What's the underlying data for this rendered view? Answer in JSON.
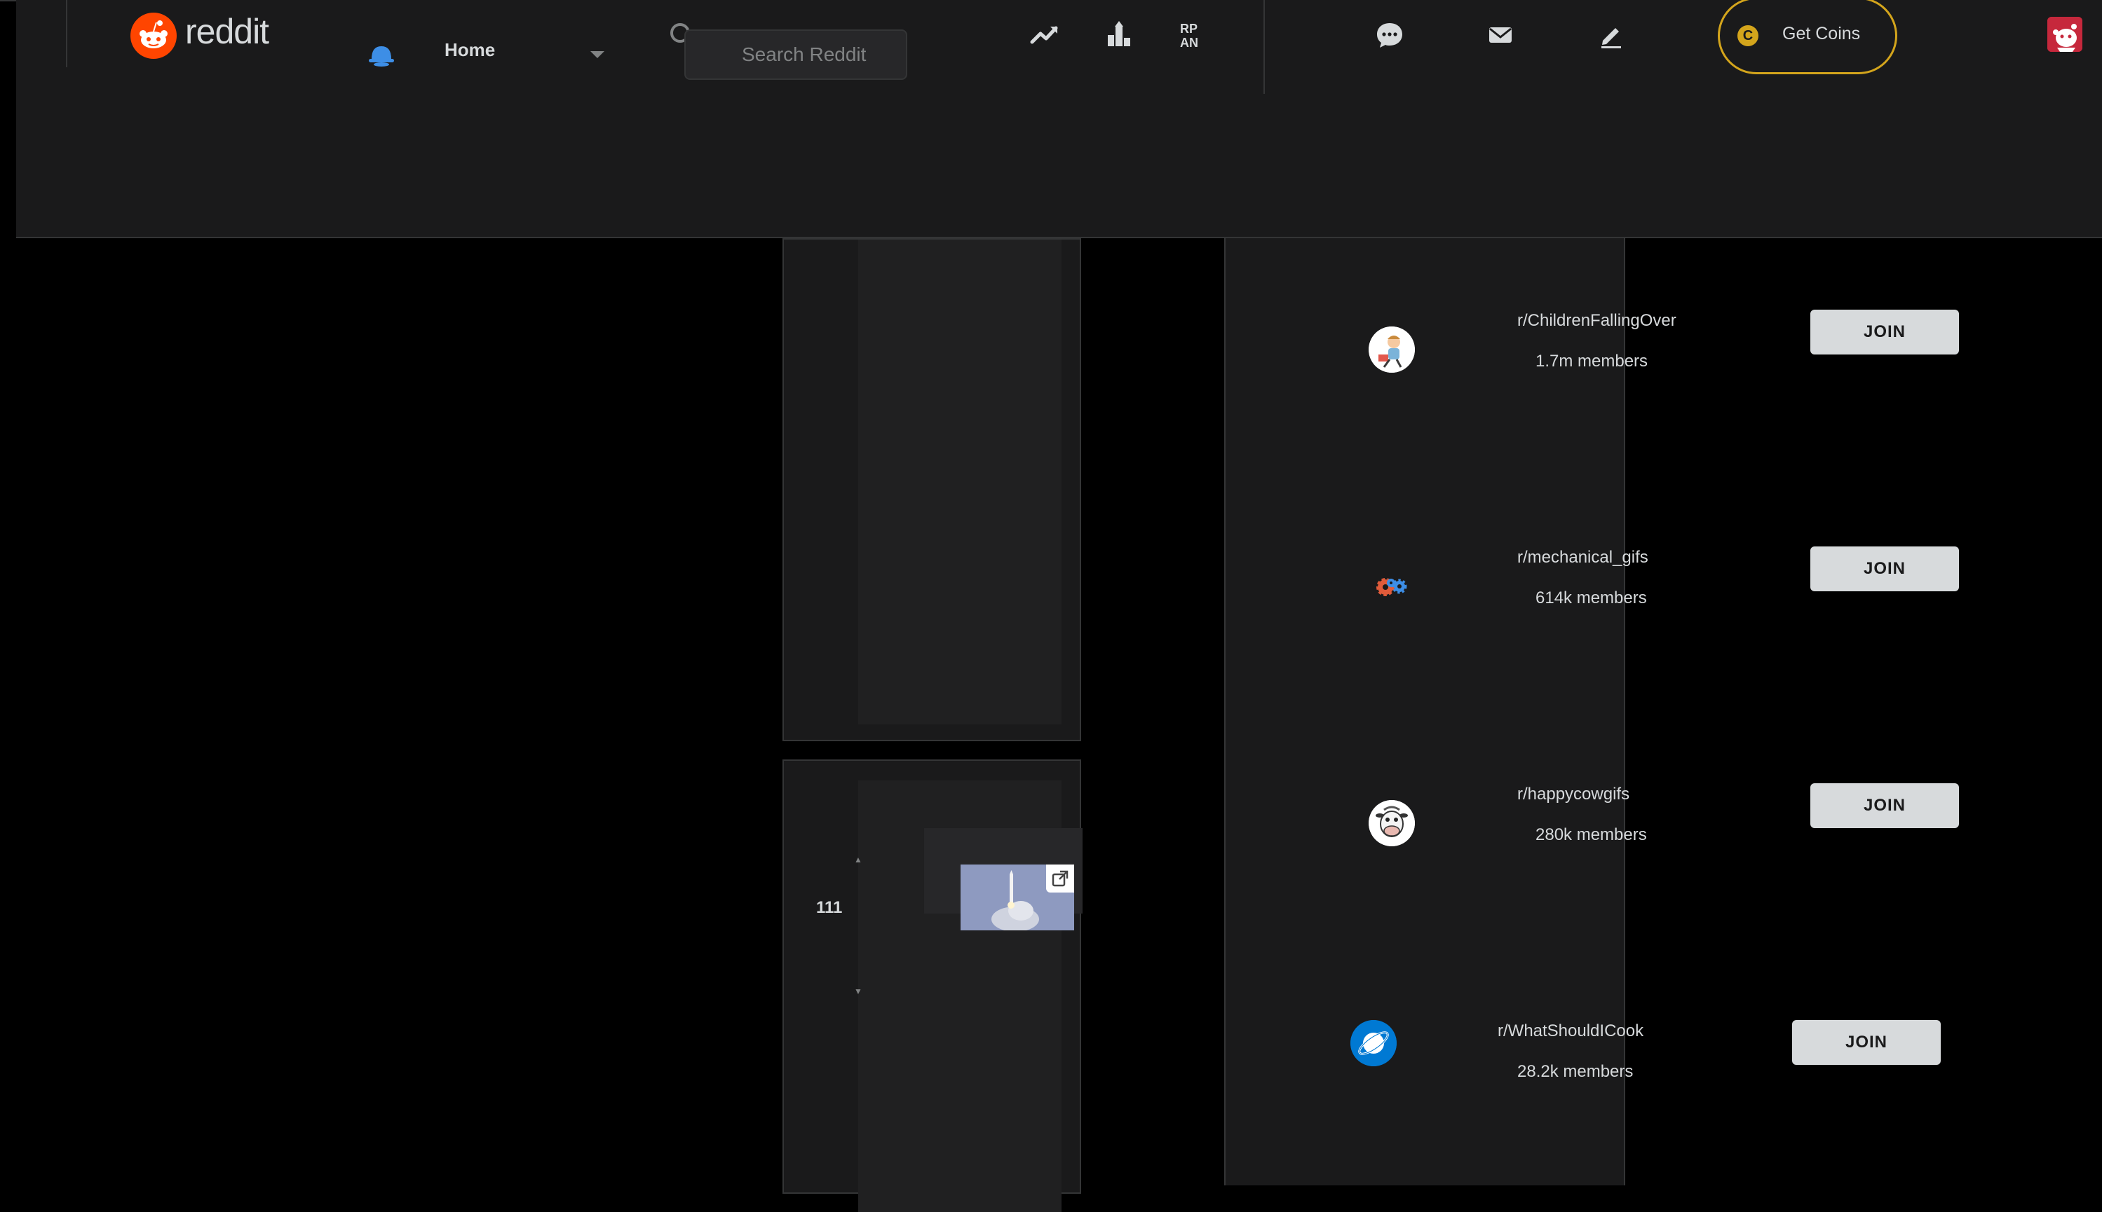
{
  "header": {
    "logo_text": "reddit",
    "home_label": "Home",
    "search": {
      "placeholder": "Search Reddit"
    },
    "nav_icons": [
      "trending-icon",
      "leaderboard-icon",
      "rpan-icon",
      "chat-icon",
      "mail-icon",
      "create-post-icon"
    ],
    "coins": {
      "symbol": "C",
      "label": "Get Coins",
      "color": "#d4a51c"
    },
    "avatar_icon": "snoo-avatar-icon"
  },
  "feed": {
    "posts": [
      {
        "votes": ""
      },
      {
        "votes": "111",
        "thumbnail_icon": "rocket-launch-thumbnail",
        "external_link_icon": "external-link-icon"
      }
    ]
  },
  "sidebar": {
    "communities": [
      {
        "name": "r/ChildrenFallingOver",
        "members": "1.7m members",
        "join_label": "JOIN",
        "icon": "children-cartoon-icon"
      },
      {
        "name": "r/mechanical_gifs",
        "members": "614k members",
        "join_label": "JOIN",
        "icon": "gears-icon"
      },
      {
        "name": "r/happycowgifs",
        "members": "280k members",
        "join_label": "JOIN",
        "icon": "cow-cartoon-icon"
      },
      {
        "name": "r/WhatShouldICook",
        "members": "28.2k members",
        "join_label": "JOIN",
        "icon": "planet-icon"
      }
    ]
  },
  "colors": {
    "page_bg": "#000000",
    "panel_bg": "#1a1a1b",
    "border": "#343536",
    "text": "#d7dadc",
    "muted": "#818384",
    "reddit_orange": "#ff4500",
    "home_blue": "#3d8ee6"
  }
}
